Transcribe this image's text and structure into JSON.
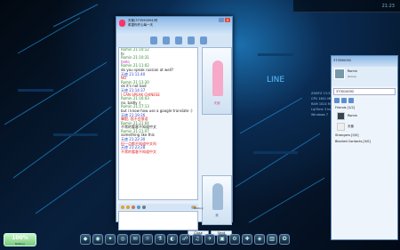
{
  "chat": {
    "title": "天使(373590094)号",
    "subtitle": "希望你开心每一天",
    "close_label": "x",
    "messages": [
      {
        "name": "Romin 21:10:12",
        "text": "hi",
        "tone": "blk"
      },
      {
        "name": "Romin 21:10:31",
        "text": "hello",
        "tone": "pk"
      },
      {
        "name": "Romin 21:11:02",
        "text": "do you speak russian at well?",
        "tone": "blk"
      },
      {
        "name": "天使 21:11:40",
        "text": "NO",
        "tone": "red"
      },
      {
        "name": "Romin 21:13:20",
        "text": "ok it's not bad",
        "tone": "blk"
      },
      {
        "name": "天使 21:14:37",
        "text": "I CAN SPEAK CHINESE",
        "tone": "red"
      },
      {
        "name": "Romin 21:16:03",
        "text": "no, badly :(",
        "tone": "blk"
      },
      {
        "name": "Romin 21:17:13",
        "text": "but i know how use a google translate :)",
        "tone": "blk"
      },
      {
        "name": "天使 21:19:26",
        "text": "晕配, 我不会俄语",
        "tone": "red"
      },
      {
        "name": "Romin 21:21:04",
        "text": "不常的看客不知道中文",
        "tone": "blk"
      },
      {
        "name": "Romin 21:21:07",
        "text": "something like this",
        "tone": "blk"
      },
      {
        "name": "天使 21:22:30",
        "text": "但一点都不知道中文吗",
        "tone": "red"
      },
      {
        "name": "天使 21:23:28",
        "text": "不常的看客不知道中文",
        "tone": "red"
      }
    ],
    "history_label": "History",
    "close_button": "Close",
    "send_button": "Send",
    "photo_caption_top": "天使",
    "photo_caption_bottom": "我"
  },
  "buddy": {
    "title": "373590092",
    "user": "Romin",
    "status": "Online",
    "search": "373010092",
    "friends_label": "Friends [1/2]",
    "friend1": "Romin",
    "friend2": "天使",
    "strangers_label": "Strangers [0/0]",
    "blocked_label": "Blocked Contacts [0/0]"
  },
  "gadget": {
    "percent": "100%",
    "caption": "Battery"
  },
  "clock": "21:23",
  "sidetext": [
    "ZAMYZ 13:32",
    "CPU 1601 MHz",
    "RAM 1024 MB",
    "LipTime 3 hours",
    "Windows 7"
  ]
}
